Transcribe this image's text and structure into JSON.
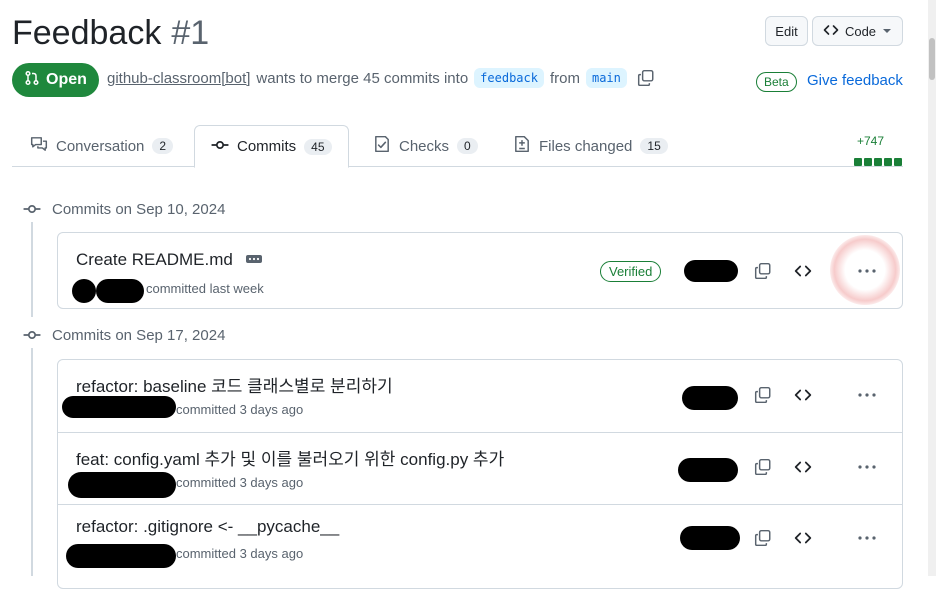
{
  "pr": {
    "title": "Feedback",
    "number": "#1",
    "state": "Open",
    "author": "github-classroom[bot]",
    "merge_text": "wants to merge 45 commits into",
    "base_branch": "feedback",
    "from_text": "from",
    "head_branch": "main"
  },
  "header_actions": {
    "edit": "Edit",
    "code": "Code"
  },
  "feedback": {
    "beta": "Beta",
    "give_feedback": "Give feedback"
  },
  "tabs": [
    {
      "label": "Conversation",
      "count": "2",
      "icon": "comment-discussion-icon"
    },
    {
      "label": "Commits",
      "count": "45",
      "icon": "git-commit-icon"
    },
    {
      "label": "Checks",
      "count": "0",
      "icon": "checklist-icon"
    },
    {
      "label": "Files changed",
      "count": "15",
      "icon": "file-diff-icon"
    }
  ],
  "diffstat": {
    "added": "+747"
  },
  "groups": [
    {
      "date_label": "Commits on Sep 10, 2024",
      "commits": [
        {
          "message": "Create README.md",
          "status": "committed last week",
          "verified": "Verified"
        }
      ]
    },
    {
      "date_label": "Commits on Sep 17, 2024",
      "commits": [
        {
          "message": "refactor: baseline 코드 클래스별로 분리하기",
          "status": "committed 3 days ago"
        },
        {
          "message": "feat: config.yaml 추가 및 이를 불러오기 위한 config.py 추가",
          "status": "committed 3 days ago"
        },
        {
          "message": "refactor: .gitignore <- __pycache__",
          "status": "committed 3 days ago"
        }
      ]
    }
  ],
  "colors": {
    "accent": "#0969da",
    "open_green": "#1f883d",
    "muted": "#59636e",
    "border": "#d1d9e0"
  }
}
